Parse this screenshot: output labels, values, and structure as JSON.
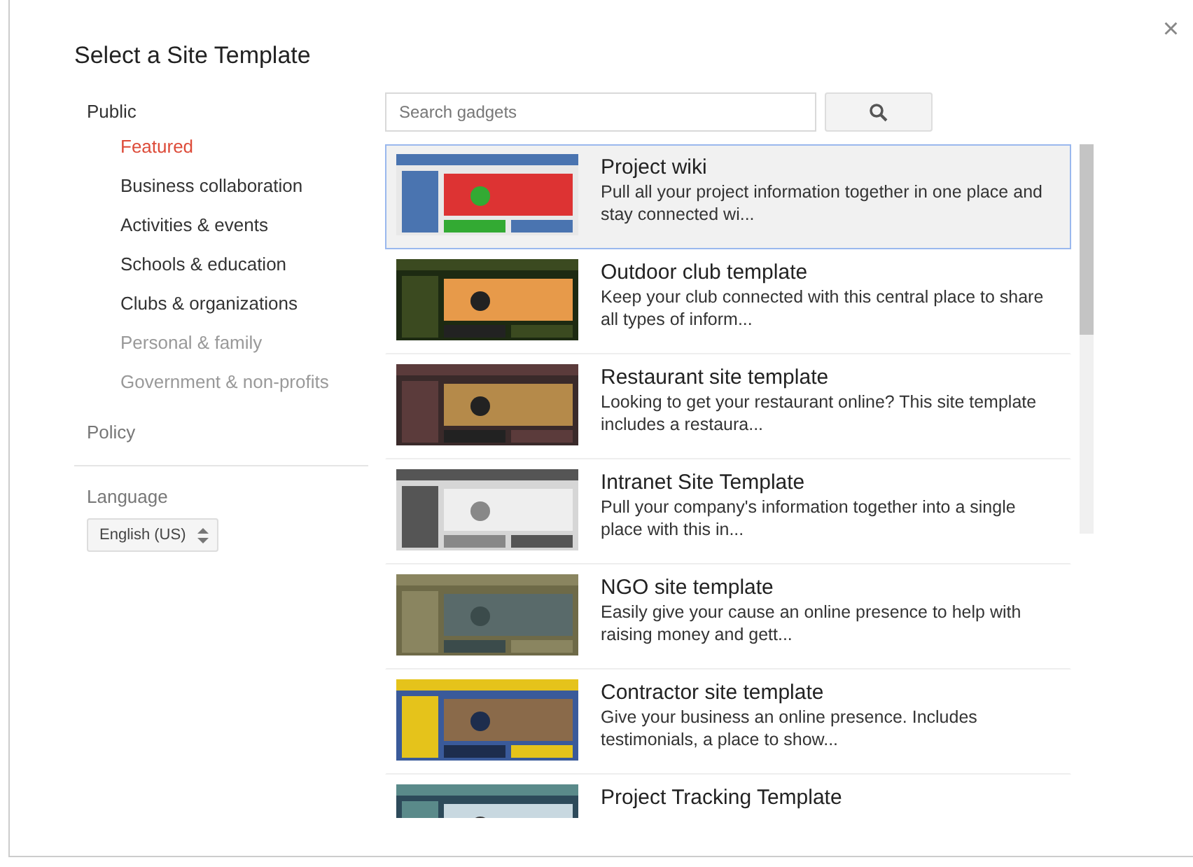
{
  "dialog": {
    "title": "Select a Site Template",
    "close": "×"
  },
  "sidebar": {
    "sections": [
      {
        "label": "Public",
        "items": [
          {
            "label": "Featured",
            "selected": true,
            "disabled": false
          },
          {
            "label": "Business collaboration",
            "selected": false,
            "disabled": false
          },
          {
            "label": "Activities & events",
            "selected": false,
            "disabled": false
          },
          {
            "label": "Schools & education",
            "selected": false,
            "disabled": false
          },
          {
            "label": "Clubs & organizations",
            "selected": false,
            "disabled": false
          },
          {
            "label": "Personal & family",
            "selected": false,
            "disabled": true
          },
          {
            "label": "Government & non-profits",
            "selected": false,
            "disabled": true
          }
        ]
      },
      {
        "label": "Policy"
      }
    ],
    "language": {
      "label": "Language",
      "value": "English (US)"
    }
  },
  "search": {
    "placeholder": "Search gadgets"
  },
  "templates": [
    {
      "title": "Project wiki",
      "description": "Pull all your project information together in one place and stay connected wi...",
      "selected": true,
      "kind": "picture"
    },
    {
      "title": "Outdoor club template",
      "description": "Keep your club connected with this central place to share all types of inform...",
      "selected": false,
      "kind": "picture"
    },
    {
      "title": "Restaurant site template",
      "description": "Looking to get your restaurant online? This site template includes a restaura...",
      "selected": false,
      "kind": "picture"
    },
    {
      "title": "Intranet Site Template",
      "description": "Pull your company's information together into a single place with this in...",
      "selected": false,
      "kind": "picture"
    },
    {
      "title": "NGO site template",
      "description": "Easily give your cause an online presence to help with raising money and gett...",
      "selected": false,
      "kind": "picture"
    },
    {
      "title": "Contractor site template",
      "description": "Give your business an online presence. Includes testimonials, a place to show...",
      "selected": false,
      "kind": "picture"
    },
    {
      "title": "Project Tracking Template",
      "selected": false,
      "kind": "picture"
    }
  ]
}
